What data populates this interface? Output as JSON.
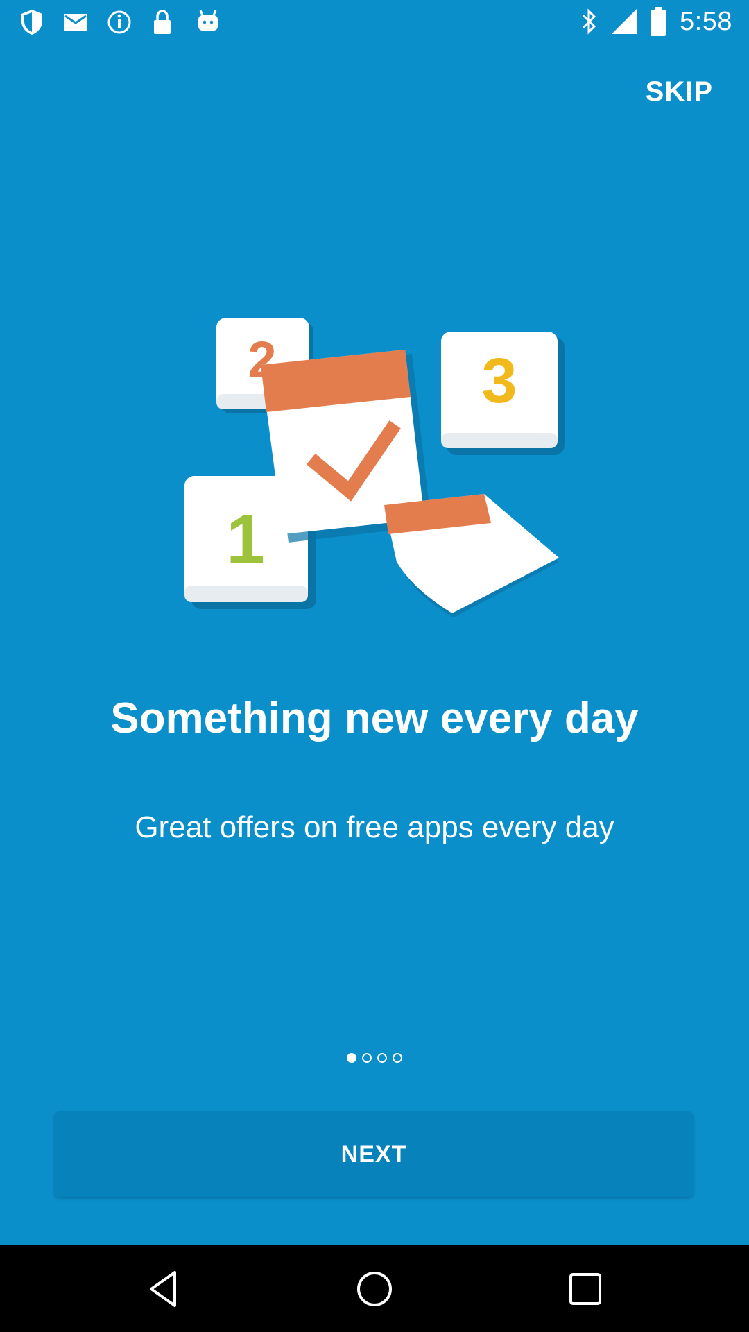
{
  "status_bar": {
    "time": "5:58",
    "left_icons": [
      "shield-icon",
      "mail-icon",
      "info-icon",
      "lock-icon",
      "android-icon"
    ],
    "right_icons": [
      "bluetooth-icon",
      "signal-icon",
      "battery-icon"
    ]
  },
  "onboarding": {
    "skip_label": "SKIP",
    "title": "Something new every day",
    "subtitle": "Great offers on free apps every day",
    "page_indicator": {
      "total": 4,
      "current": 1
    },
    "next_label": "NEXT",
    "illustration_numbers": [
      "2",
      "3",
      "1"
    ]
  },
  "colors": {
    "background": "#0b8fcb",
    "button": "#0782bb",
    "calendar_header": "#e47d4e",
    "number_two": "#e47d4e",
    "number_three": "#f2b91d",
    "number_one": "#9dc23b"
  },
  "nav_bar": {
    "buttons": [
      "back-icon",
      "home-icon",
      "recents-icon"
    ]
  }
}
